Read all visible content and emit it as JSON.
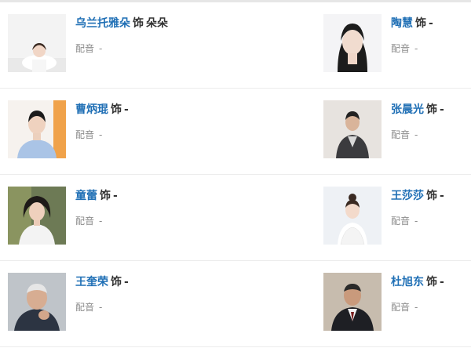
{
  "cast": [
    {
      "actor": "乌兰托雅朵",
      "as": "饰",
      "role": "朵朵",
      "voice_label": "配音",
      "voice_value": "-"
    },
    {
      "actor": "陶慧",
      "as": "饰",
      "role": "-",
      "voice_label": "配音",
      "voice_value": "-"
    },
    {
      "actor": "曹炳琨",
      "as": "饰",
      "role": "-",
      "voice_label": "配音",
      "voice_value": "-"
    },
    {
      "actor": "张晨光",
      "as": "饰",
      "role": "-",
      "voice_label": "配音",
      "voice_value": "-"
    },
    {
      "actor": "童蕾",
      "as": "饰",
      "role": "-",
      "voice_label": "配音",
      "voice_value": "-"
    },
    {
      "actor": "王莎莎",
      "as": "饰",
      "role": "-",
      "voice_label": "配音",
      "voice_value": "-"
    },
    {
      "actor": "王奎荣",
      "as": "饰",
      "role": "-",
      "voice_label": "配音",
      "voice_value": "-"
    },
    {
      "actor": "杜旭东",
      "as": "饰",
      "role": "-",
      "voice_label": "配音",
      "voice_value": "-"
    }
  ]
}
